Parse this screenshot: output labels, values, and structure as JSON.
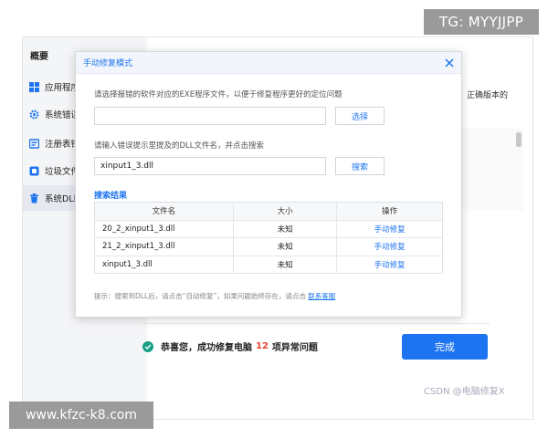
{
  "overlays": {
    "tg_badge": "TG: MYYJJPP",
    "url_badge": "www.kfzc-k8.com",
    "csdn": "CSDN @电脑修复X"
  },
  "sidebar": {
    "title": "概要",
    "items": [
      {
        "label": "应用程序",
        "icon": "apps-icon"
      },
      {
        "label": "系统错误",
        "icon": "gear-icon"
      },
      {
        "label": "注册表错",
        "icon": "registry-icon"
      },
      {
        "label": "垃圾文件",
        "icon": "junk-icon"
      },
      {
        "label": "系统DLL",
        "icon": "trash-icon"
      }
    ]
  },
  "main": {
    "partial_text": "正确版本的",
    "status_prefix": "恭喜您，成功修复电脑",
    "status_count": "12",
    "status_suffix": "项异常问题",
    "done_label": "完成"
  },
  "modal": {
    "title": "手动修复模式",
    "exe_label": "请选择报错的软件对应的EXE程序文件，以便于修复程序更好的定位问题",
    "exe_value": "",
    "select_label": "选择",
    "dll_label": "请输入错误提示里提及的DLL文件名，并点击搜索",
    "dll_value": "xinput1_3.dll",
    "search_label": "搜索",
    "results_title": "搜索结果",
    "table": {
      "headers": [
        "文件名",
        "大小",
        "操作"
      ],
      "rows": [
        {
          "name": "20_2_xinput1_3.dll",
          "size": "未知",
          "action": "手动修复"
        },
        {
          "name": "21_2_xinput1_3.dll",
          "size": "未知",
          "action": "手动修复"
        },
        {
          "name": "xinput1_3.dll",
          "size": "未知",
          "action": "手动修复"
        }
      ]
    },
    "tip_text": "提示：搜索到DLL后，请点击“自动修复”，如果问题始终存在，请点击",
    "tip_link": "联系客服"
  },
  "colors": {
    "accent": "#1e74f0",
    "success": "#16a085",
    "count": "#e8452c"
  }
}
